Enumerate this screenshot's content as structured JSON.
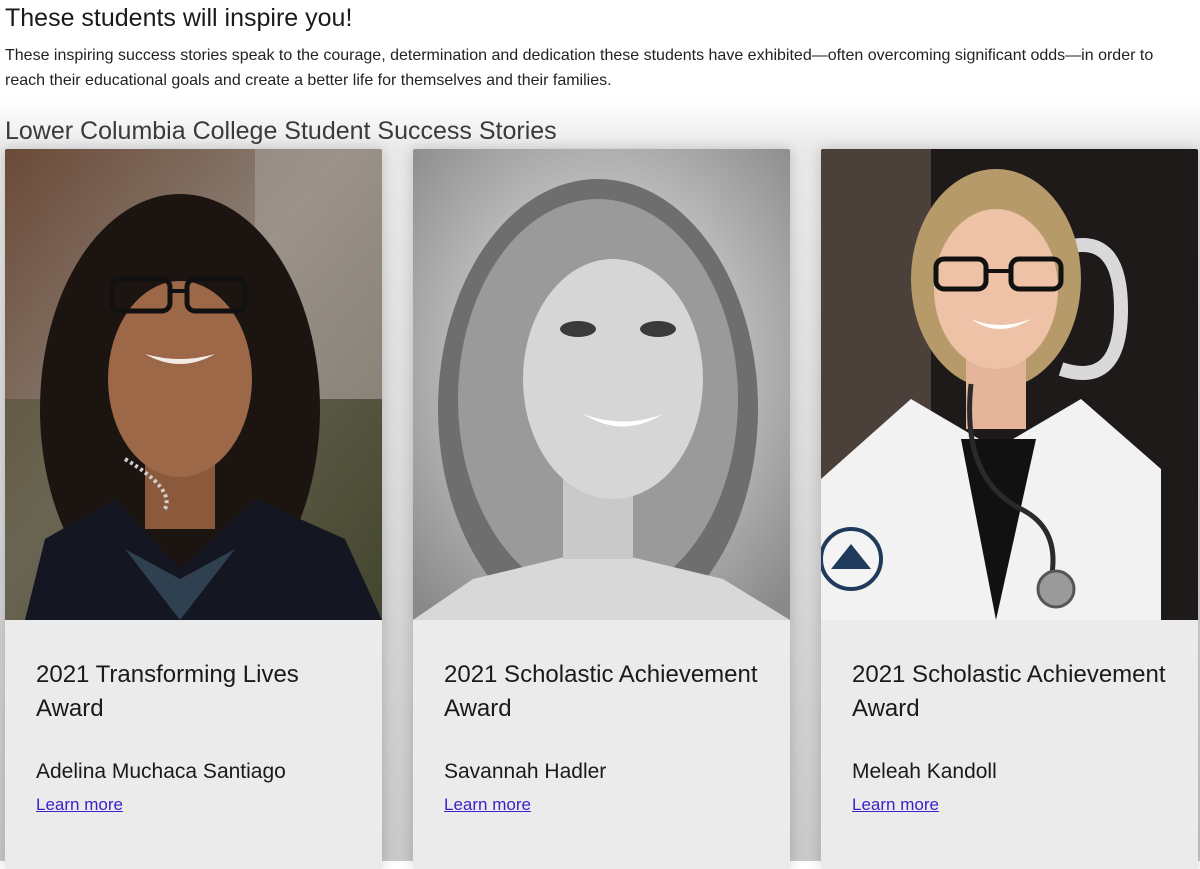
{
  "header": {
    "title": "These students will inspire you!",
    "intro": "These inspiring success stories speak to the courage, determination and dedication these students have exhibited—often overcoming significant odds—in order to reach their educational goals and create a better life for themselves and their families."
  },
  "section": {
    "title": "Lower Columbia College Student Success Stories"
  },
  "cards": [
    {
      "award": "2021 Transforming Lives Award",
      "name": "Adelina Muchaca Santiago",
      "link": "Learn more"
    },
    {
      "award": "2021 Scholastic Achievement Award",
      "name": "Savannah Hadler",
      "link": "Learn more"
    },
    {
      "award": "2021 Scholastic Achievement Award",
      "name": "Meleah Kandoll",
      "link": "Learn more"
    }
  ],
  "colors": {
    "link": "#3a22c8",
    "card_background": "#ebebeb"
  }
}
